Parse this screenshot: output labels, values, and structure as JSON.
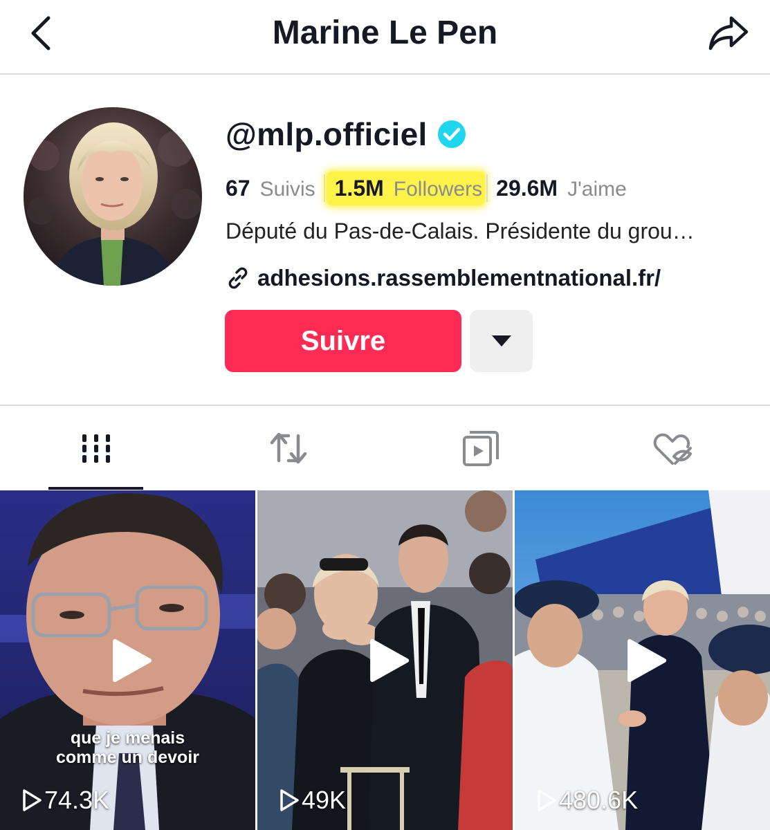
{
  "header": {
    "title": "Marine Le Pen",
    "back_icon": "chevron-left-icon",
    "share_icon": "share-arrow-icon"
  },
  "profile": {
    "handle": "@mlp.officiel",
    "verified": true,
    "verified_color": "#20d5ec",
    "stats": {
      "following": {
        "value": "67",
        "label": "Suivis"
      },
      "followers": {
        "value": "1.5M",
        "label": "Followers",
        "highlighted": true,
        "highlight_color": "#fff34a"
      },
      "likes": {
        "value": "29.6M",
        "label": "J'aime"
      }
    },
    "bio": "Député du Pas-de-Calais. Présidente du grou…",
    "link": "adhesions.rassemblementnational.fr/",
    "follow_button": "Suivre",
    "follow_color": "#fe2c55"
  },
  "tabs": [
    {
      "name": "videos",
      "icon": "grid-icon",
      "active": true
    },
    {
      "name": "reposts",
      "icon": "repost-icon",
      "active": false
    },
    {
      "name": "playlists",
      "icon": "playlist-icon",
      "active": false
    },
    {
      "name": "liked",
      "icon": "heart-hidden-icon",
      "active": false
    }
  ],
  "videos": [
    {
      "views": "74.3K",
      "caption": "que je menais\ncomme un devoir"
    },
    {
      "views": "49K",
      "caption": ""
    },
    {
      "views": "480.6K",
      "caption": ""
    }
  ]
}
